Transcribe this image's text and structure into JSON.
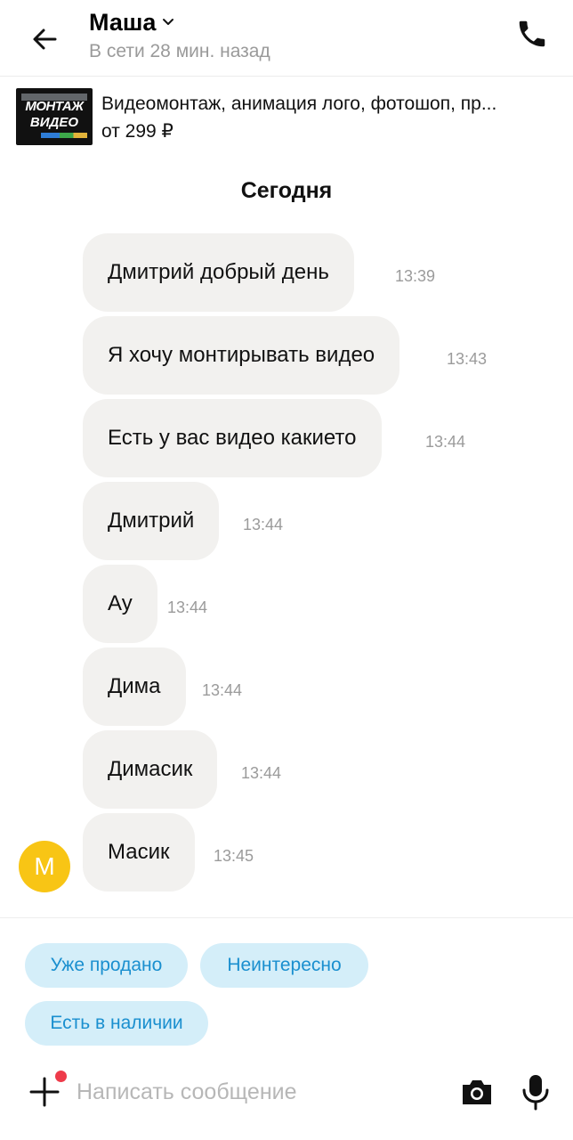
{
  "header": {
    "contact_name": "Маша",
    "status": "В сети 28 мин. назад",
    "icons": {
      "back": "back-arrow-icon",
      "chevron": "chevron-down-icon",
      "call": "phone-icon"
    }
  },
  "listing": {
    "thumb_line1": "МОНТАЖ",
    "thumb_line2": "ВИДЕО",
    "title": "Видеомонтаж, анимация лого, фотошоп, пр...",
    "price": "от 299 ₽"
  },
  "date_label": "Сегодня",
  "messages": [
    {
      "text": "Дмитрий добрый день",
      "time": "13:39"
    },
    {
      "text": "Я хочу монтирывать видео",
      "time": "13:43"
    },
    {
      "text": "Есть у вас видео какието",
      "time": "13:44"
    },
    {
      "text": "Дмитрий",
      "time": "13:44"
    },
    {
      "text": "Ау",
      "time": "13:44"
    },
    {
      "text": "Дима",
      "time": "13:44"
    },
    {
      "text": "Димасик",
      "time": "13:44"
    },
    {
      "text": "Масик",
      "time": "13:45"
    }
  ],
  "avatar_letter": "М",
  "quick_replies": [
    "Уже продано",
    "Неинтересно",
    "Есть в наличии"
  ],
  "input": {
    "placeholder": "Написать сообщение",
    "icons": {
      "attach": "plus-icon",
      "camera": "camera-icon",
      "mic": "microphone-icon"
    }
  },
  "colors": {
    "bubble": "#f2f1ef",
    "avatar": "#f8c515",
    "chip_bg": "#d4eef9",
    "chip_text": "#1a8fcf",
    "notification_dot": "#ee3b4a"
  }
}
